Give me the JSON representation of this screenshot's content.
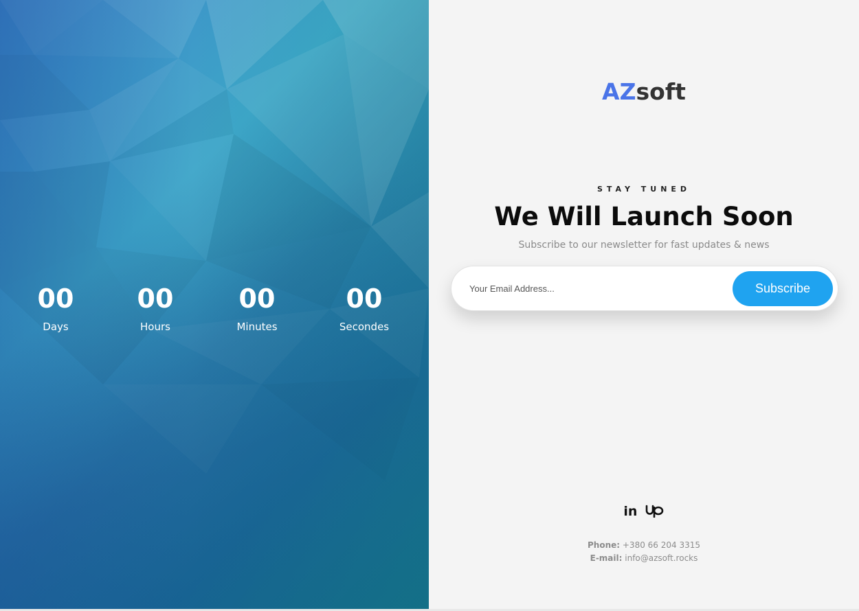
{
  "countdown": [
    {
      "value": "00",
      "label": "Days"
    },
    {
      "value": "00",
      "label": "Hours"
    },
    {
      "value": "00",
      "label": "Minutes"
    },
    {
      "value": "00",
      "label": "Secondes"
    }
  ],
  "logo": {
    "az": "AZ",
    "soft": "soft"
  },
  "hero": {
    "eyebrow": "STAY TUNED",
    "headline": "We Will Launch Soon",
    "subline": "Subscribe to our newsletter for fast updates & news"
  },
  "subscribe": {
    "placeholder": "Your Email Address...",
    "button": "Subscribe"
  },
  "social": {
    "linkedin": "in",
    "upwork_icon": "upwork-icon"
  },
  "contact": {
    "phone_label": "Phone:",
    "phone": "+380 66 204 3315",
    "email_label": "E-mail:",
    "email": "info@azsoft.rocks"
  },
  "colors": {
    "accent": "#1fa3f0",
    "logo_blue": "#4a74e8",
    "gradient_start": "#3d86c9",
    "gradient_end": "#127a85"
  }
}
